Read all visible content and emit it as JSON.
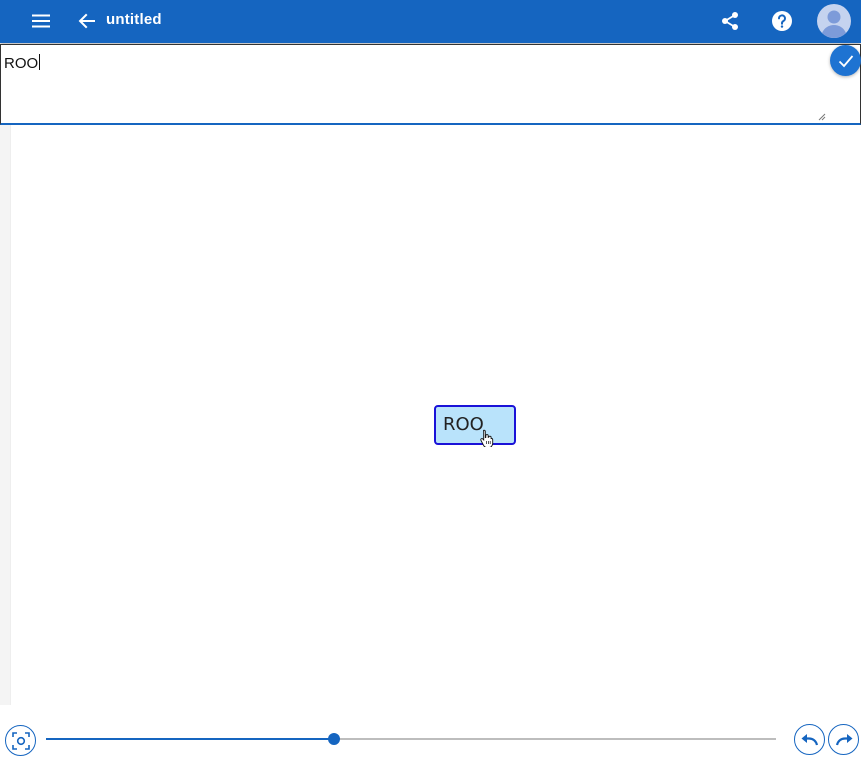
{
  "appbar": {
    "title": "untitled",
    "background": "#1565c0",
    "icons": [
      "menu-icon",
      "arrow-back-icon",
      "share-icon",
      "help-icon",
      "account-icon"
    ]
  },
  "editor": {
    "value": "ROO"
  },
  "canvas": {
    "node": {
      "label": "ROO",
      "fill": "#b9e3fb",
      "border": "#1a12d8"
    }
  },
  "controls": {
    "zoom_progress": 0.395,
    "icons": [
      "fit-view-icon",
      "undo-icon",
      "redo-icon",
      "check-icon"
    ]
  }
}
